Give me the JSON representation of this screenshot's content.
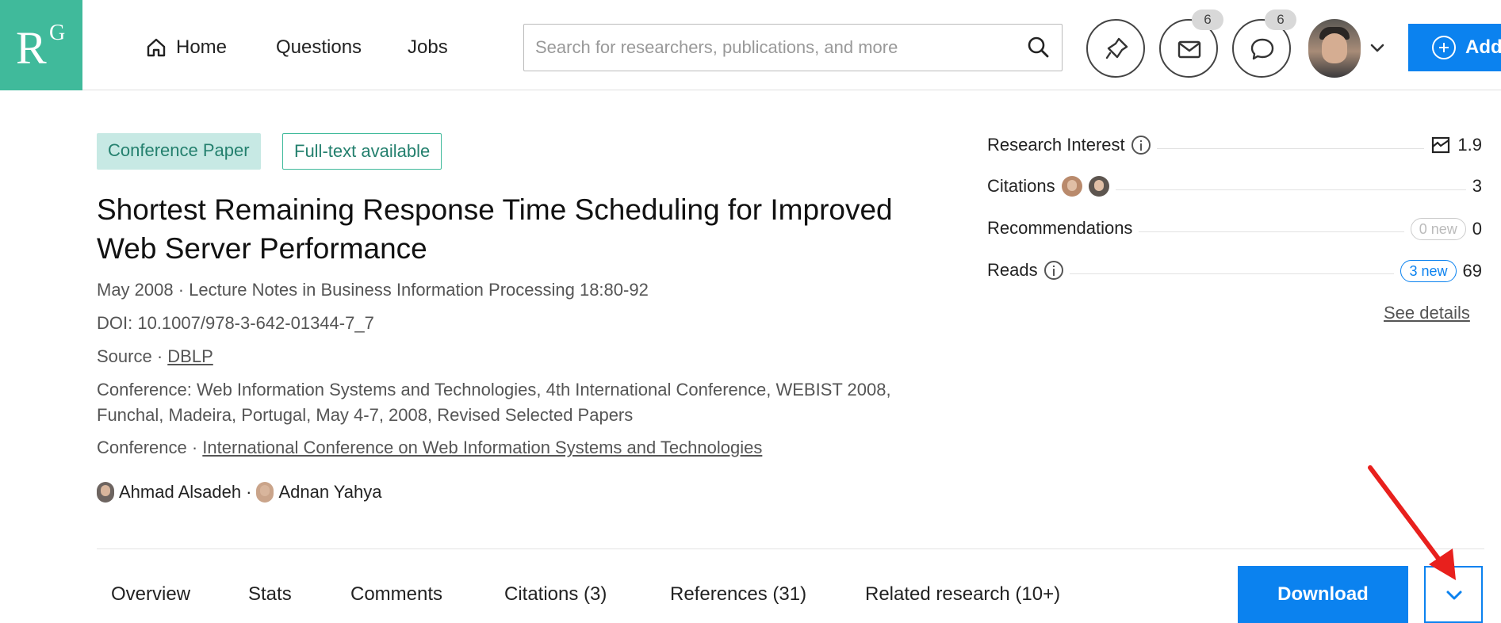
{
  "logo": {
    "r": "R",
    "g": "G"
  },
  "nav": {
    "home": "Home",
    "questions": "Questions",
    "jobs": "Jobs"
  },
  "search": {
    "placeholder": "Search for researchers, publications, and more"
  },
  "notifications": {
    "messages_count": "6",
    "comments_count": "6"
  },
  "add_button": {
    "label": "Add"
  },
  "publication": {
    "type_tag": "Conference Paper",
    "fulltext_tag": "Full-text available",
    "title": "Shortest Remaining Response Time Scheduling for Improved Web Server Performance",
    "date_journal": "May 2008 · Lecture Notes in Business Information Processing 18:80-92",
    "doi": "DOI: 10.1007/978-3-642-01344-7_7",
    "source_prefix": "Source · ",
    "source_link": "DBLP",
    "conference_full": "Conference: Web Information Systems and Technologies, 4th International Conference, WEBIST 2008, Funchal, Madeira, Portugal, May 4-7, 2008, Revised Selected Papers",
    "conference_prefix": "Conference · ",
    "conference_link": "International Conference on Web Information Systems and Technologies",
    "authors": [
      "Ahmad Alsadeh",
      "Adnan Yahya"
    ],
    "author_separator": " · "
  },
  "tabs": [
    {
      "label": "Overview"
    },
    {
      "label": "Stats"
    },
    {
      "label": "Comments"
    },
    {
      "label": "Citations (3)"
    },
    {
      "label": "References (31)"
    },
    {
      "label": "Related research (10+)"
    }
  ],
  "actions": {
    "download": "Download"
  },
  "stats": {
    "research_interest": {
      "label": "Research Interest",
      "value": "1.9"
    },
    "citations": {
      "label": "Citations",
      "value": "3"
    },
    "recommendations": {
      "label": "Recommendations",
      "new": "0 new",
      "value": "0"
    },
    "reads": {
      "label": "Reads",
      "new": "3 new",
      "value": "69"
    },
    "see_details": "See details"
  },
  "colors": {
    "brand": "#40ba9b",
    "primary": "#0b82ef",
    "annotation_arrow": "#e8201d"
  }
}
